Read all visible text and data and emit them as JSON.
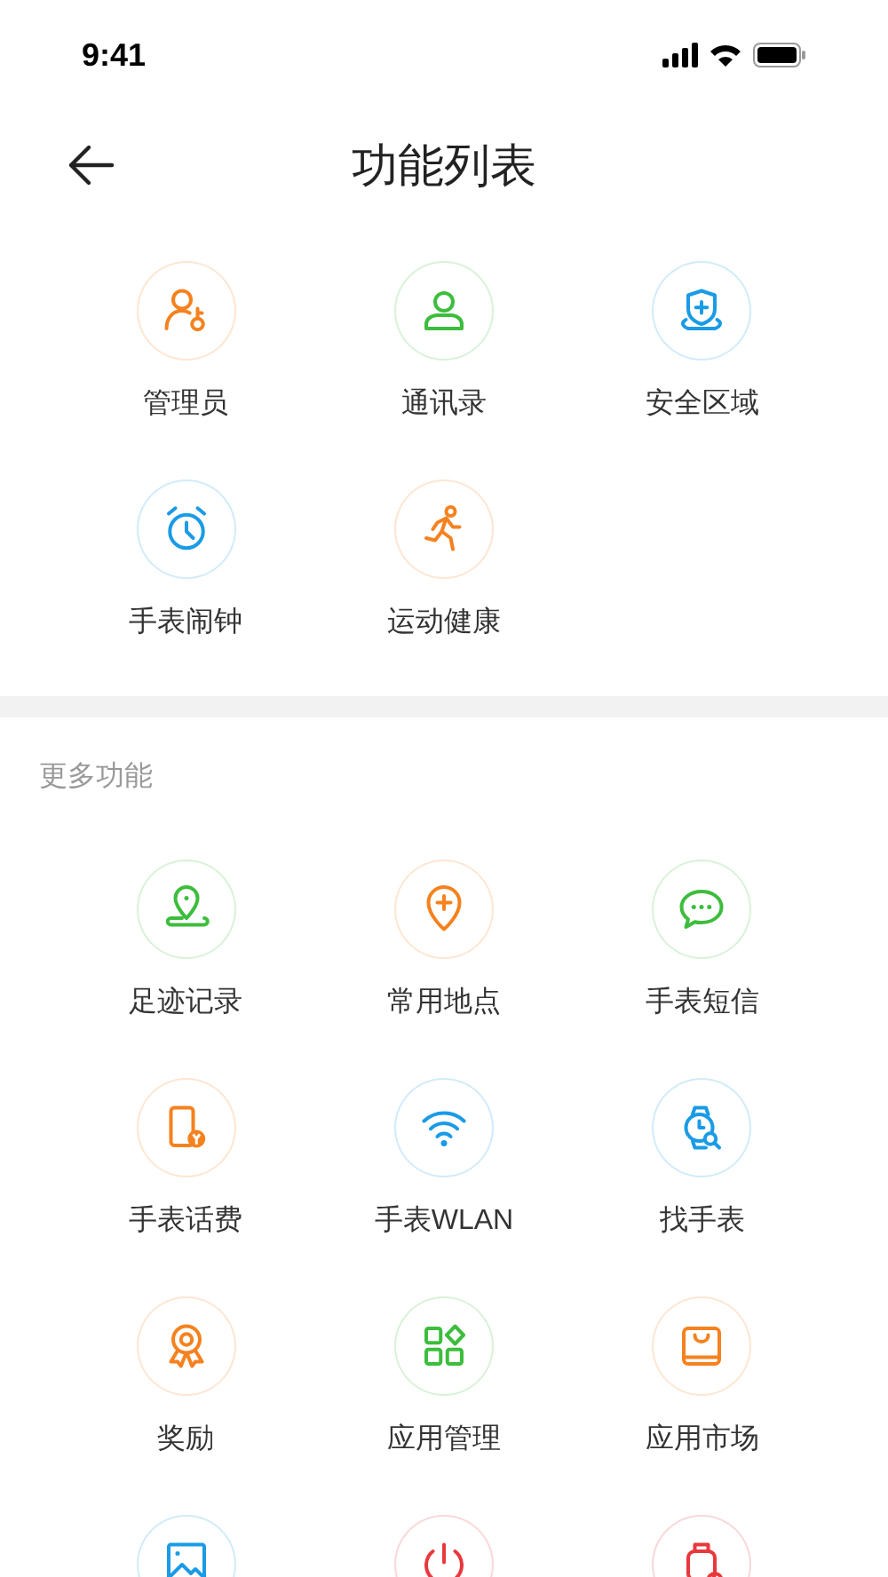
{
  "status_bar": {
    "time": "9:41"
  },
  "header": {
    "title": "功能列表"
  },
  "main_functions": [
    {
      "kind": "admin",
      "color": "#f5821f",
      "label": "管理员"
    },
    {
      "kind": "contact",
      "color": "#3dbd3d",
      "label": "通讯录"
    },
    {
      "kind": "shield",
      "color": "#1a9be6",
      "label": "安全区域"
    },
    {
      "kind": "alarm",
      "color": "#1a9be6",
      "label": "手表闹钟"
    },
    {
      "kind": "run",
      "color": "#f5821f",
      "label": "运动健康"
    }
  ],
  "more_section": {
    "title": "更多功能",
    "items": [
      {
        "kind": "track",
        "color": "#3dbd3d",
        "label": "足迹记录"
      },
      {
        "kind": "place",
        "color": "#f5821f",
        "label": "常用地点"
      },
      {
        "kind": "message",
        "color": "#3dbd3d",
        "label": "手表短信"
      },
      {
        "kind": "phonefee",
        "color": "#f5821f",
        "label": "手表话费"
      },
      {
        "kind": "wifi",
        "color": "#1a9be6",
        "label": "手表WLAN"
      },
      {
        "kind": "findwatch",
        "color": "#1a9be6",
        "label": "找手表"
      },
      {
        "kind": "medal",
        "color": "#f5821f",
        "label": "奖励"
      },
      {
        "kind": "apps",
        "color": "#3dbd3d",
        "label": "应用管理"
      },
      {
        "kind": "bag",
        "color": "#f5821f",
        "label": "应用市场"
      },
      {
        "kind": "image",
        "color": "#1a9be6"
      },
      {
        "kind": "power",
        "color": "#e8383d"
      },
      {
        "kind": "watchoff",
        "color": "#e8383d"
      }
    ]
  }
}
